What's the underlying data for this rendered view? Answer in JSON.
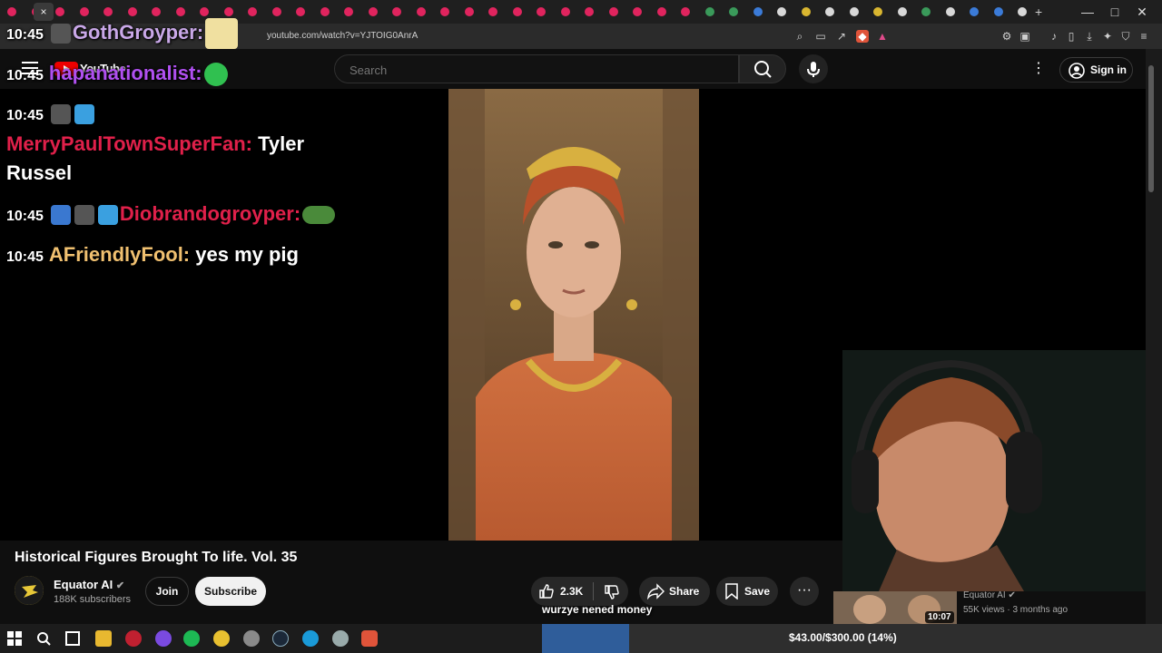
{
  "browser": {
    "url": "youtube.com/watch?v=YJTOIG0AnrA",
    "close_tab": "×",
    "new_tab": "+",
    "minimize": "—",
    "maximize": "□",
    "close_window": "✕"
  },
  "header": {
    "brand": "YouTube",
    "search_placeholder": "Search",
    "signin_label": "Sign in"
  },
  "chat": [
    {
      "time": "10:45",
      "user": "GothGroyper:",
      "user_color": "#c9a8e8",
      "message": ""
    },
    {
      "time": "10:45",
      "user": "hapanationalist:",
      "user_color": "#b050f0",
      "message": ""
    },
    {
      "time": "10:45",
      "user": "",
      "user_color": "#ffffff",
      "message": ""
    },
    {
      "time": "",
      "user": "MerryPaulTownSuperFan:",
      "user_color": "#e0204a",
      "message": "Tyler"
    },
    {
      "time": "",
      "user": "",
      "user_color": "#ffffff",
      "message": "Russel"
    },
    {
      "time": "10:45",
      "user": "Diobrandogroyper:",
      "user_color": "#e0204a",
      "message": ""
    },
    {
      "time": "10:45",
      "user": "AFriendlyFool:",
      "user_color": "#f0c070",
      "message": "yes my pig"
    }
  ],
  "video": {
    "title": "Historical Figures Brought To life. Vol. 35",
    "channel_name": "Equator AI",
    "subscribers": "188K subscribers",
    "join_label": "Join",
    "subscribe_label": "Subscribe",
    "likes": "2.3K",
    "share_label": "Share",
    "save_label": "Save",
    "more_label": "···"
  },
  "caption": "wurzye nened money",
  "recommended": {
    "channel": "Equator AI",
    "meta": "55K views · 3 months ago",
    "duration": "10:07"
  },
  "goal": {
    "text": "$43.00/$300.00 (14%)",
    "progress": 0.14
  },
  "colors": {
    "accent_red": "#ff0000",
    "page_bg": "#0f0f0f",
    "goal_fill": "#2f5d9a"
  },
  "icons": [
    "menu-icon",
    "search-icon",
    "mic-icon",
    "more-vert-icon",
    "account-icon",
    "like-icon",
    "dislike-icon",
    "share-icon",
    "save-icon",
    "windows-start-icon",
    "taskbar-search-icon"
  ]
}
